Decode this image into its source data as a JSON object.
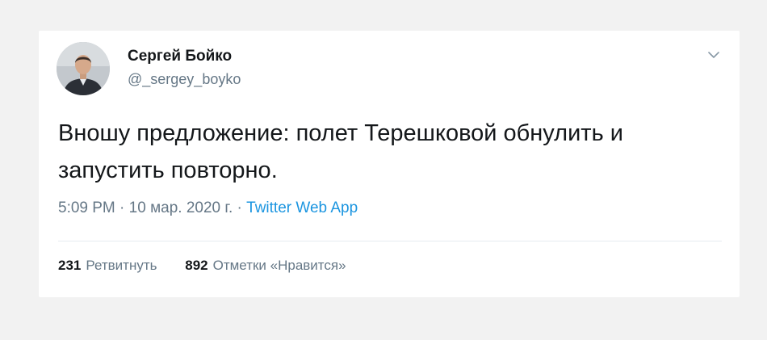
{
  "author": {
    "name": "Сергей Бойко",
    "handle": "@_sergey_boyko",
    "avatar_icon": "person-photo"
  },
  "tweet": {
    "text": "Вношу предложение: полет Терешковой обнулить и запустить повторно."
  },
  "meta": {
    "time": "5:09 PM",
    "separator": " · ",
    "date": "10 мар. 2020 г.",
    "source": "Twitter Web App"
  },
  "stats": {
    "retweets_count": "231",
    "retweets_label": "Ретвитнуть",
    "likes_count": "892",
    "likes_label": "Отметки «Нравится»"
  },
  "icons": {
    "menu": "chevron-down-icon"
  },
  "colors": {
    "link": "#1b95e0",
    "secondary_text": "#657786",
    "primary_text": "#14171a",
    "background": "#f2f2f2"
  }
}
